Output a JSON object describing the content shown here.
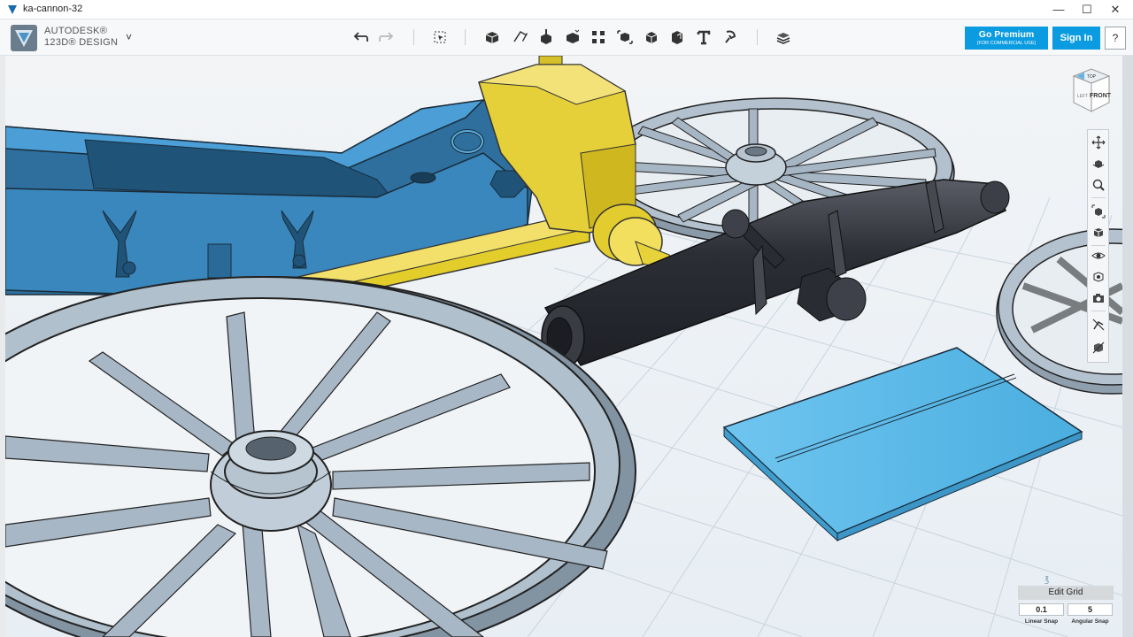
{
  "window": {
    "title": "ka-cannon-32",
    "minimize_glyph": "—",
    "maximize_glyph": "☐",
    "close_glyph": "✕"
  },
  "brand": {
    "line1": "AUTODESK®",
    "line2": "123D® DESIGN",
    "menu_glyph": "˅"
  },
  "toolbar": {
    "icons": [
      "undo-icon",
      "redo-icon",
      "transform-icon",
      "primitives-icon",
      "sketch-icon",
      "construct-icon",
      "modify-icon",
      "pattern-icon",
      "grouping-icon",
      "combine-icon",
      "measure-icon",
      "text-icon",
      "snap-icon",
      "material-icon"
    ]
  },
  "account": {
    "premium_label": "Go Premium",
    "premium_sub": "(FOR COMMERCIAL USE)",
    "signin_label": "Sign In",
    "help_label": "?"
  },
  "viewcube": {
    "top": "TOP",
    "front": "FRONT",
    "left": "LEFT"
  },
  "navbar": {
    "icons": [
      "pan-icon",
      "orbit-icon",
      "zoom-icon",
      "fit-icon",
      "views-icon",
      "visibility-icon",
      "materials-outline-icon",
      "camera-icon",
      "hide-sketch-icon",
      "hide-mesh-icon"
    ]
  },
  "grid": {
    "edit_label": "Edit Grid",
    "linear_snap_value": "0.1",
    "angular_snap_value": "5",
    "linear_snap_label": "Linear Snap",
    "angular_snap_label": "Angular Snap"
  },
  "colors": {
    "accent": "#0a9be0",
    "carriage_blue": "#3d8fc4",
    "axle_yellow": "#e8d23a",
    "wheel_gray": "#a9b8c6",
    "barrel_dark": "#2f3138",
    "plate_blue": "#5bbde9",
    "grid_bg": "#eef2f6"
  }
}
